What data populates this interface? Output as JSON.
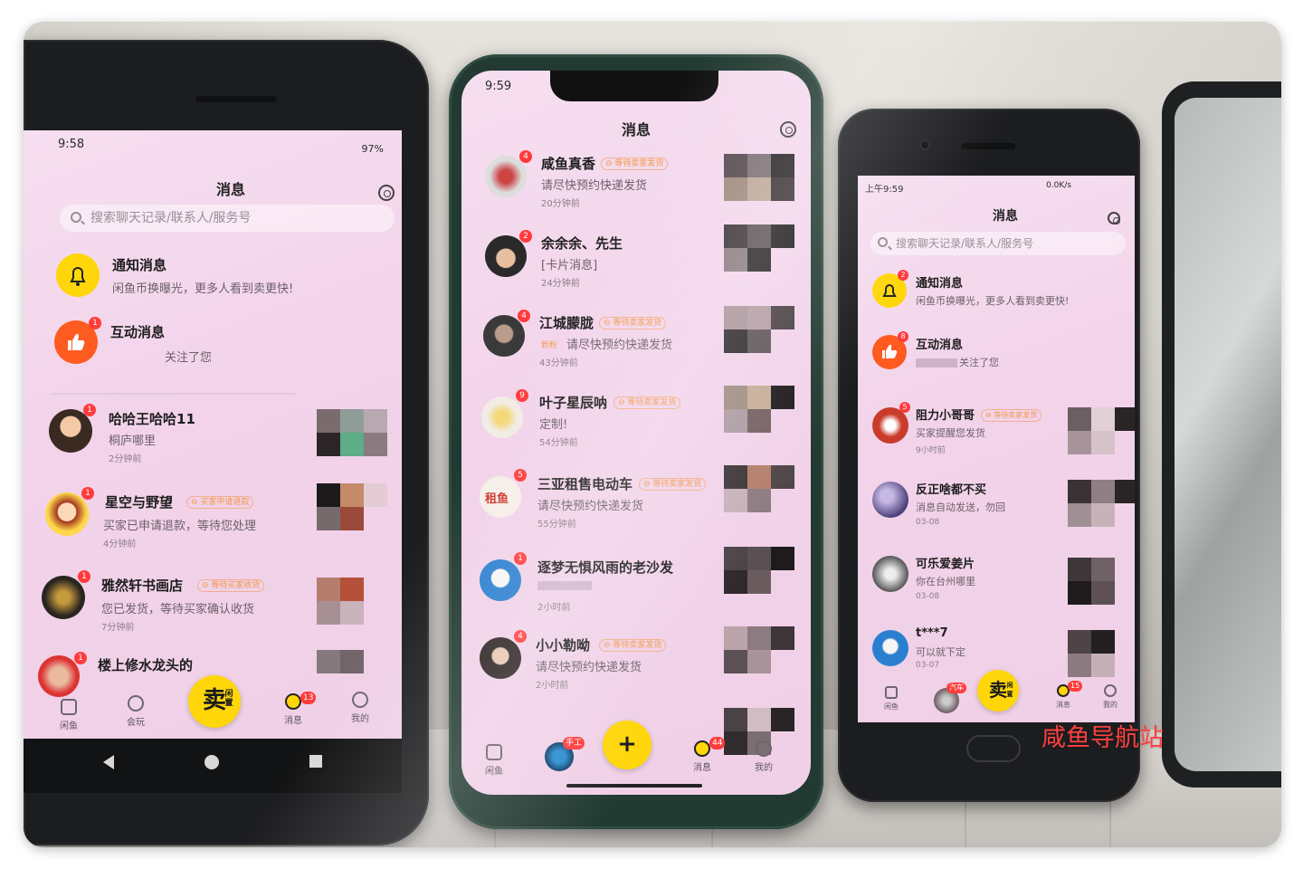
{
  "watermark": "咸鱼导航站",
  "phone_left": {
    "status": {
      "time": "9:58",
      "battery": "97%"
    },
    "title": "消息",
    "search_placeholder": "搜索聊天记录/联系人/服务号",
    "notify": {
      "name": "通知消息",
      "text": "闲鱼币换曝光，更多人看到卖更快!"
    },
    "interact": {
      "name": "互动消息",
      "badge": "1",
      "text": "关注了您"
    },
    "chats": [
      {
        "name": "哈哈王哈哈11",
        "badge": "1",
        "tag": "",
        "text": "桐庐哪里",
        "time": "2分钟前"
      },
      {
        "name": "星空与野望",
        "badge": "1",
        "tag": "买家申请退款",
        "text": "买家已申请退款，等待您处理",
        "time": "4分钟前"
      },
      {
        "name": "雅然轩书画店",
        "badge": "1",
        "tag": "等待买家收货",
        "text": "您已发货，等待买家确认收货",
        "time": "7分钟前"
      },
      {
        "name": "楼上修水龙头的",
        "badge": "1",
        "tag": "",
        "text": "",
        "time": ""
      }
    ],
    "tabs": {
      "home": "闲鱼",
      "play": "会玩",
      "sell": "卖",
      "sell_small": "闲置",
      "msg": "消息",
      "msg_badge": "13",
      "me": "我的"
    }
  },
  "phone_mid": {
    "status": {
      "time": "9:59"
    },
    "title": "消息",
    "chats": [
      {
        "name": "咸鱼真香",
        "badge": "4",
        "tag": "等待卖家发货",
        "text": "请尽快预约快递发货",
        "time": "20分钟前"
      },
      {
        "name": "余余余、先生",
        "badge": "2",
        "tag": "",
        "text": "[卡片消息]",
        "time": "24分钟前"
      },
      {
        "name": "江城朦胧",
        "badge": "4",
        "tag": "等待卖家发货",
        "newfans": "新粉",
        "text": "请尽快预约快递发货",
        "time": "43分钟前"
      },
      {
        "name": "叶子星辰呐",
        "badge": "9",
        "tag": "等待卖家发货",
        "text": "定制!",
        "time": "54分钟前"
      },
      {
        "name": "三亚租售电动车",
        "badge": "5",
        "tag": "等待卖家发货",
        "text": "请尽快预约快递发货",
        "time": "55分钟前"
      },
      {
        "name": "逐梦无惧风雨的老沙发",
        "badge": "1",
        "tag": "",
        "text": "",
        "time": "2小时前"
      },
      {
        "name": "小小勒呦",
        "badge": "4",
        "tag": "等待卖家发货",
        "text": "请尽快预约快递发货",
        "time": "2小时前"
      }
    ],
    "avatar_text": "租鱼",
    "tabs": {
      "home": "闲鱼",
      "craft": "手工",
      "plus": "+",
      "msg": "消息",
      "msg_badge": "44",
      "me": "我的"
    }
  },
  "phone_right": {
    "status": {
      "time": "上午9:59",
      "net": "0.0K/s"
    },
    "title": "消息",
    "search_placeholder": "搜索聊天记录/联系人/服务号",
    "notify": {
      "name": "通知消息",
      "badge": "2",
      "text": "闲鱼币换曝光，更多人看到卖更快!"
    },
    "interact": {
      "name": "互动消息",
      "badge": "8",
      "text": "关注了您"
    },
    "chats": [
      {
        "name": "阻力小哥哥",
        "badge": "5",
        "tag": "等待卖家发货",
        "text": "买家提醒您发货",
        "time": "9小时前"
      },
      {
        "name": "反正啥都不买",
        "badge": "",
        "tag": "",
        "text": "消息自动发送，勿回",
        "time": "03-08"
      },
      {
        "name": "可乐爱姜片",
        "badge": "",
        "tag": "",
        "text": "你在台州哪里",
        "time": "03-08"
      },
      {
        "name": "t***7",
        "badge": "",
        "tag": "",
        "text": "可以就下定",
        "time": "03-07"
      }
    ],
    "tabs": {
      "home": "闲鱼",
      "car": "汽车",
      "sell": "卖",
      "sell_small": "闲置",
      "msg": "消息",
      "msg_badge": "15",
      "me": "我的"
    }
  }
}
